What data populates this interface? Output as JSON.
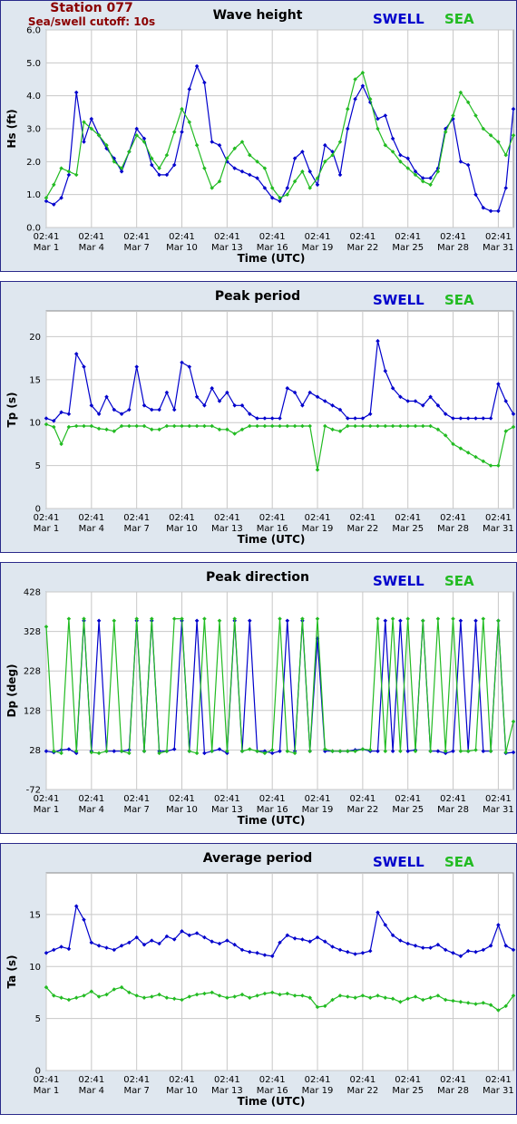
{
  "header": {
    "station": "Station 077",
    "cutoff": "Sea/swell cutoff: 10s"
  },
  "legend": {
    "swell": "SWELL",
    "sea": "SEA"
  },
  "colors": {
    "swell": "#0000cc",
    "sea": "#22bb22",
    "grid": "#c8c8c8",
    "station": "#8b0000"
  },
  "x_ticks": [
    {
      "time": "02:41",
      "date": "Mar 1"
    },
    {
      "time": "02:41",
      "date": "Mar 4"
    },
    {
      "time": "02:41",
      "date": "Mar 7"
    },
    {
      "time": "02:41",
      "date": "Mar 10"
    },
    {
      "time": "02:41",
      "date": "Mar 13"
    },
    {
      "time": "02:41",
      "date": "Mar 16"
    },
    {
      "time": "02:41",
      "date": "Mar 19"
    },
    {
      "time": "02:41",
      "date": "Mar 22"
    },
    {
      "time": "02:41",
      "date": "Mar 25"
    },
    {
      "time": "02:41",
      "date": "Mar 28"
    },
    {
      "time": "02:41",
      "date": "Mar 31"
    }
  ],
  "chart_data": [
    {
      "type": "line",
      "title": "Wave height",
      "xlabel": "Time (UTC)",
      "ylabel": "Hs (ft)",
      "ylim": [
        0,
        6
      ],
      "y_ticks": [
        "0.0",
        "1.0",
        "2.0",
        "3.0",
        "4.0",
        "5.0",
        "6.0"
      ],
      "grid": true,
      "legend_position": "top-right",
      "x": [
        "Mar 1",
        "Mar 1.5",
        "Mar 2",
        "Mar 2.5",
        "Mar 3",
        "Mar 3.5",
        "Mar 4",
        "Mar 4.5",
        "Mar 5",
        "Mar 5.5",
        "Mar 6",
        "Mar 6.5",
        "Mar 7",
        "Mar 7.5",
        "Mar 8",
        "Mar 8.5",
        "Mar 9",
        "Mar 9.5",
        "Mar 10",
        "Mar 10.5",
        "Mar 11",
        "Mar 11.5",
        "Mar 12",
        "Mar 12.5",
        "Mar 13",
        "Mar 13.5",
        "Mar 14",
        "Mar 14.5",
        "Mar 15",
        "Mar 15.5",
        "Mar 16",
        "Mar 16.5",
        "Mar 17",
        "Mar 17.5",
        "Mar 18",
        "Mar 18.5",
        "Mar 19",
        "Mar 19.5",
        "Mar 20",
        "Mar 20.5",
        "Mar 21",
        "Mar 21.5",
        "Mar 22",
        "Mar 22.5",
        "Mar 23",
        "Mar 23.5",
        "Mar 24",
        "Mar 24.5",
        "Mar 25",
        "Mar 25.5",
        "Mar 26",
        "Mar 26.5",
        "Mar 27",
        "Mar 27.5",
        "Mar 28",
        "Mar 28.5",
        "Mar 29",
        "Mar 29.5",
        "Mar 30",
        "Mar 30.5",
        "Mar 31",
        "Mar 31.5",
        "Mar 32"
      ],
      "series": [
        {
          "name": "SWELL",
          "values": [
            0.8,
            0.7,
            0.9,
            1.6,
            4.1,
            2.6,
            3.3,
            2.8,
            2.4,
            2.1,
            1.7,
            2.3,
            3.0,
            2.7,
            1.9,
            1.6,
            1.6,
            1.9,
            2.9,
            4.2,
            4.9,
            4.4,
            2.6,
            2.5,
            2.0,
            1.8,
            1.7,
            1.6,
            1.5,
            1.2,
            0.9,
            0.8,
            1.2,
            2.1,
            2.3,
            1.7,
            1.3,
            2.5,
            2.3,
            1.6,
            3.0,
            3.9,
            4.3,
            3.8,
            3.3,
            3.4,
            2.7,
            2.2,
            2.1,
            1.7,
            1.5,
            1.5,
            1.8,
            3.0,
            3.3,
            2.0,
            1.9,
            1.0,
            0.6,
            0.5,
            0.5,
            1.2,
            3.6
          ]
        },
        {
          "name": "SEA",
          "values": [
            0.9,
            1.3,
            1.8,
            1.7,
            1.6,
            3.2,
            3.0,
            2.8,
            2.5,
            2.0,
            1.8,
            2.3,
            2.8,
            2.6,
            2.1,
            1.8,
            2.2,
            2.9,
            3.6,
            3.2,
            2.5,
            1.8,
            1.2,
            1.4,
            2.1,
            2.4,
            2.6,
            2.2,
            2.0,
            1.8,
            1.2,
            0.9,
            1.0,
            1.4,
            1.7,
            1.2,
            1.5,
            2.0,
            2.2,
            2.6,
            3.6,
            4.5,
            4.7,
            3.9,
            3.0,
            2.5,
            2.3,
            2.0,
            1.8,
            1.6,
            1.4,
            1.3,
            1.7,
            2.9,
            3.4,
            4.1,
            3.8,
            3.4,
            3.0,
            2.8,
            2.6,
            2.2,
            2.8
          ]
        }
      ]
    },
    {
      "type": "line",
      "title": "Peak period",
      "xlabel": "Time (UTC)",
      "ylabel": "Tp (s)",
      "ylim": [
        0,
        23
      ],
      "y_ticks": [
        "0",
        "5",
        "10",
        "15",
        "20"
      ],
      "grid": true,
      "legend_position": "top-right",
      "x": [
        "Mar 1",
        "Mar 1.5",
        "Mar 2",
        "Mar 2.5",
        "Mar 3",
        "Mar 3.5",
        "Mar 4",
        "Mar 4.5",
        "Mar 5",
        "Mar 5.5",
        "Mar 6",
        "Mar 6.5",
        "Mar 7",
        "Mar 7.5",
        "Mar 8",
        "Mar 8.5",
        "Mar 9",
        "Mar 9.5",
        "Mar 10",
        "Mar 10.5",
        "Mar 11",
        "Mar 11.5",
        "Mar 12",
        "Mar 12.5",
        "Mar 13",
        "Mar 13.5",
        "Mar 14",
        "Mar 14.5",
        "Mar 15",
        "Mar 15.5",
        "Mar 16",
        "Mar 16.5",
        "Mar 17",
        "Mar 17.5",
        "Mar 18",
        "Mar 18.5",
        "Mar 19",
        "Mar 19.5",
        "Mar 20",
        "Mar 20.5",
        "Mar 21",
        "Mar 21.5",
        "Mar 22",
        "Mar 22.5",
        "Mar 23",
        "Mar 23.5",
        "Mar 24",
        "Mar 24.5",
        "Mar 25",
        "Mar 25.5",
        "Mar 26",
        "Mar 26.5",
        "Mar 27",
        "Mar 27.5",
        "Mar 28",
        "Mar 28.5",
        "Mar 29",
        "Mar 29.5",
        "Mar 30",
        "Mar 30.5",
        "Mar 31",
        "Mar 31.5",
        "Mar 32"
      ],
      "series": [
        {
          "name": "SWELL",
          "values": [
            10.5,
            10.2,
            11.2,
            11.0,
            18.0,
            16.5,
            12.0,
            11.0,
            13.0,
            11.5,
            11.0,
            11.5,
            16.5,
            12.0,
            11.5,
            11.5,
            13.5,
            11.5,
            17.0,
            16.5,
            13.0,
            12.0,
            14.0,
            12.5,
            13.5,
            12.0,
            12.0,
            11.0,
            10.5,
            10.5,
            10.5,
            10.5,
            14.0,
            13.5,
            12.0,
            13.5,
            13.0,
            12.5,
            12.0,
            11.5,
            10.5,
            10.5,
            10.5,
            11.0,
            19.5,
            16.0,
            14.0,
            13.0,
            12.5,
            12.5,
            12.0,
            13.0,
            12.0,
            11.0,
            10.5,
            10.5,
            10.5,
            10.5,
            10.5,
            10.5,
            14.5,
            12.5,
            11.0
          ]
        },
        {
          "name": "SEA",
          "values": [
            9.8,
            9.5,
            7.5,
            9.5,
            9.6,
            9.6,
            9.6,
            9.3,
            9.2,
            9.0,
            9.6,
            9.6,
            9.6,
            9.6,
            9.2,
            9.2,
            9.6,
            9.6,
            9.6,
            9.6,
            9.6,
            9.6,
            9.6,
            9.2,
            9.2,
            8.7,
            9.2,
            9.6,
            9.6,
            9.6,
            9.6,
            9.6,
            9.6,
            9.6,
            9.6,
            9.6,
            4.5,
            9.6,
            9.2,
            9.0,
            9.6,
            9.6,
            9.6,
            9.6,
            9.6,
            9.6,
            9.6,
            9.6,
            9.6,
            9.6,
            9.6,
            9.6,
            9.2,
            8.5,
            7.5,
            7.0,
            6.5,
            6.0,
            5.5,
            5.0,
            5.0,
            9.0,
            9.5
          ]
        }
      ]
    },
    {
      "type": "line",
      "title": "Peak direction",
      "xlabel": "Time (UTC)",
      "ylabel": "Dp (deg)",
      "ylim": [
        -72,
        428
      ],
      "y_ticks": [
        "-72",
        "28",
        "128",
        "228",
        "328",
        "428"
      ],
      "grid": true,
      "legend_position": "top-right",
      "x": [
        "Mar 1",
        "Mar 1.5",
        "Mar 2",
        "Mar 2.5",
        "Mar 3",
        "Mar 3.5",
        "Mar 4",
        "Mar 4.5",
        "Mar 5",
        "Mar 5.5",
        "Mar 6",
        "Mar 6.5",
        "Mar 7",
        "Mar 7.5",
        "Mar 8",
        "Mar 8.5",
        "Mar 9",
        "Mar 9.5",
        "Mar 10",
        "Mar 10.5",
        "Mar 11",
        "Mar 11.5",
        "Mar 12",
        "Mar 12.5",
        "Mar 13",
        "Mar 13.5",
        "Mar 14",
        "Mar 14.5",
        "Mar 15",
        "Mar 15.5",
        "Mar 16",
        "Mar 16.5",
        "Mar 17",
        "Mar 17.5",
        "Mar 18",
        "Mar 18.5",
        "Mar 19",
        "Mar 19.5",
        "Mar 20",
        "Mar 20.5",
        "Mar 21",
        "Mar 21.5",
        "Mar 22",
        "Mar 22.5",
        "Mar 23",
        "Mar 23.5",
        "Mar 24",
        "Mar 24.5",
        "Mar 25",
        "Mar 25.5",
        "Mar 26",
        "Mar 26.5",
        "Mar 27",
        "Mar 27.5",
        "Mar 28",
        "Mar 28.5",
        "Mar 29",
        "Mar 29.5",
        "Mar 30",
        "Mar 30.5",
        "Mar 31",
        "Mar 31.5",
        "Mar 32"
      ],
      "series": [
        {
          "name": "SWELL",
          "values": [
            25,
            22,
            28,
            30,
            20,
            355,
            25,
            355,
            25,
            25,
            25,
            28,
            355,
            25,
            355,
            25,
            25,
            30,
            355,
            25,
            355,
            20,
            25,
            30,
            20,
            355,
            25,
            355,
            25,
            25,
            20,
            25,
            355,
            25,
            355,
            25,
            310,
            25,
            25,
            25,
            25,
            28,
            30,
            25,
            25,
            355,
            25,
            355,
            25,
            28,
            355,
            25,
            25,
            20,
            25,
            355,
            25,
            355,
            25,
            25,
            355,
            20,
            22
          ]
        },
        {
          "name": "SEA",
          "values": [
            340,
            25,
            20,
            360,
            25,
            360,
            22,
            20,
            25,
            355,
            25,
            20,
            360,
            25,
            360,
            20,
            25,
            360,
            360,
            25,
            20,
            360,
            25,
            355,
            25,
            360,
            25,
            30,
            25,
            20,
            28,
            360,
            25,
            20,
            360,
            25,
            360,
            30,
            25,
            25,
            25,
            25,
            30,
            28,
            360,
            25,
            360,
            25,
            360,
            25,
            355,
            25,
            360,
            25,
            360,
            25,
            25,
            28,
            360,
            25,
            355,
            22,
            100
          ]
        }
      ]
    },
    {
      "type": "line",
      "title": "Average period",
      "xlabel": "Time (UTC)",
      "ylabel": "Ta (s)",
      "ylim": [
        0,
        19
      ],
      "y_ticks": [
        "0",
        "5",
        "10",
        "15"
      ],
      "grid": true,
      "legend_position": "top-right",
      "x": [
        "Mar 1",
        "Mar 1.5",
        "Mar 2",
        "Mar 2.5",
        "Mar 3",
        "Mar 3.5",
        "Mar 4",
        "Mar 4.5",
        "Mar 5",
        "Mar 5.5",
        "Mar 6",
        "Mar 6.5",
        "Mar 7",
        "Mar 7.5",
        "Mar 8",
        "Mar 8.5",
        "Mar 9",
        "Mar 9.5",
        "Mar 10",
        "Mar 10.5",
        "Mar 11",
        "Mar 11.5",
        "Mar 12",
        "Mar 12.5",
        "Mar 13",
        "Mar 13.5",
        "Mar 14",
        "Mar 14.5",
        "Mar 15",
        "Mar 15.5",
        "Mar 16",
        "Mar 16.5",
        "Mar 17",
        "Mar 17.5",
        "Mar 18",
        "Mar 18.5",
        "Mar 19",
        "Mar 19.5",
        "Mar 20",
        "Mar 20.5",
        "Mar 21",
        "Mar 21.5",
        "Mar 22",
        "Mar 22.5",
        "Mar 23",
        "Mar 23.5",
        "Mar 24",
        "Mar 24.5",
        "Mar 25",
        "Mar 25.5",
        "Mar 26",
        "Mar 26.5",
        "Mar 27",
        "Mar 27.5",
        "Mar 28",
        "Mar 28.5",
        "Mar 29",
        "Mar 29.5",
        "Mar 30",
        "Mar 30.5",
        "Mar 31",
        "Mar 31.5",
        "Mar 32"
      ],
      "series": [
        {
          "name": "SWELL",
          "values": [
            11.3,
            11.6,
            11.9,
            11.7,
            15.8,
            14.5,
            12.3,
            12.0,
            11.8,
            11.6,
            12.0,
            12.3,
            12.8,
            12.1,
            12.5,
            12.2,
            12.9,
            12.6,
            13.4,
            13.0,
            13.2,
            12.8,
            12.4,
            12.2,
            12.5,
            12.1,
            11.6,
            11.4,
            11.3,
            11.1,
            11.0,
            12.3,
            13.0,
            12.7,
            12.6,
            12.4,
            12.8,
            12.4,
            11.9,
            11.6,
            11.4,
            11.2,
            11.3,
            11.5,
            15.2,
            14.0,
            13.0,
            12.5,
            12.2,
            12.0,
            11.8,
            11.8,
            12.1,
            11.6,
            11.3,
            11.0,
            11.5,
            11.4,
            11.6,
            12.0,
            14.0,
            12.0,
            11.6
          ]
        },
        {
          "name": "SEA",
          "values": [
            8.0,
            7.2,
            7.0,
            6.8,
            7.0,
            7.2,
            7.6,
            7.1,
            7.3,
            7.8,
            8.0,
            7.5,
            7.2,
            7.0,
            7.1,
            7.3,
            7.0,
            6.9,
            6.8,
            7.1,
            7.3,
            7.4,
            7.5,
            7.2,
            7.0,
            7.1,
            7.3,
            7.0,
            7.2,
            7.4,
            7.5,
            7.3,
            7.4,
            7.2,
            7.2,
            7.0,
            6.1,
            6.2,
            6.8,
            7.2,
            7.1,
            7.0,
            7.2,
            7.0,
            7.2,
            7.0,
            6.9,
            6.6,
            6.9,
            7.1,
            6.8,
            7.0,
            7.2,
            6.8,
            6.7,
            6.6,
            6.5,
            6.4,
            6.5,
            6.3,
            5.8,
            6.2,
            7.2
          ]
        }
      ]
    }
  ]
}
